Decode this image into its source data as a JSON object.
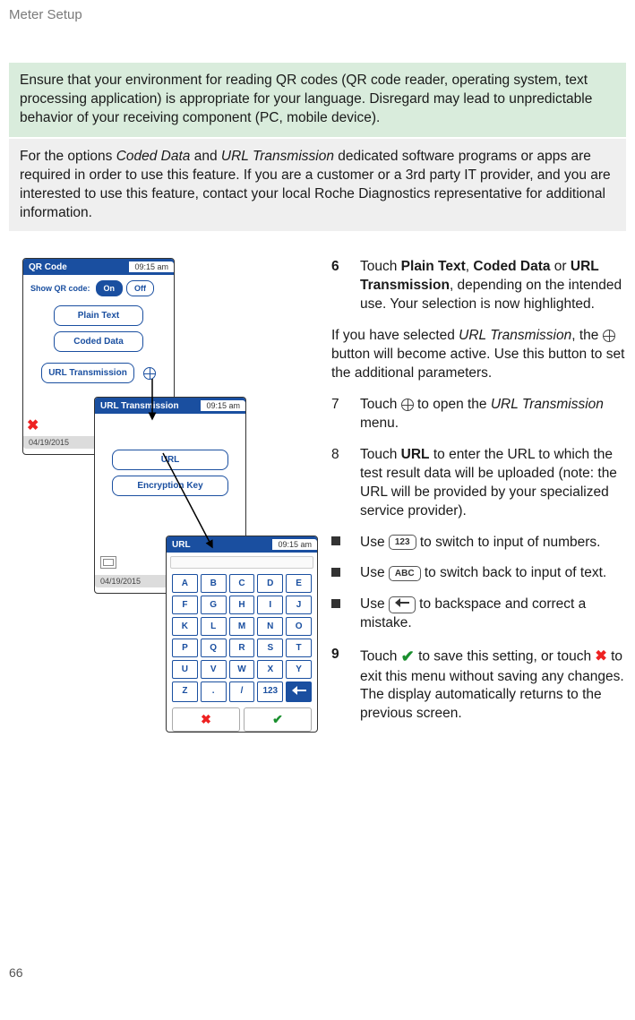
{
  "header": "Meter Setup",
  "page_number": "66",
  "note_green": "Ensure that your environment for reading QR codes (QR code reader, operating system, text processing application) is appropriate for your language. Disregard may lead to unpredictable behavior of your receiving component (PC, mobile device).",
  "note_grey_pre": "For the options ",
  "note_grey_it1": "Coded Data",
  "note_grey_mid": " and ",
  "note_grey_it2": "URL Transmission",
  "note_grey_post": " dedicated software programs or apps are required in order to use this feature. If you are a customer or a 3rd party IT provider, and you are interested to use this feature, contact your local Roche Diagnostics representative for additional information.",
  "screens": {
    "qr": {
      "title": "QR Code",
      "time": "09:15 am",
      "show_label": "Show QR code:",
      "on": "On",
      "off": "Off",
      "opt_plain": "Plain Text",
      "opt_coded": "Coded Data",
      "opt_url": "URL Transmission",
      "date": "04/19/2015"
    },
    "urltrans": {
      "title": "URL Transmission",
      "time": "09:15 am",
      "btn_url": "URL",
      "btn_enc": "Encryption Key",
      "date": "04/19/2015"
    },
    "urlkb": {
      "title": "URL",
      "time": "09:15 am",
      "keys": [
        "A",
        "B",
        "C",
        "D",
        "E",
        "F",
        "G",
        "H",
        "I",
        "J",
        "K",
        "L",
        "M",
        "N",
        "O",
        "P",
        "Q",
        "R",
        "S",
        "T",
        "U",
        "V",
        "W",
        "X",
        "Y",
        "Z",
        ".",
        "/",
        "123"
      ]
    }
  },
  "steps": {
    "s6num": "6",
    "s6_a": "Touch ",
    "s6_b": "Plain Text",
    "s6_c": ", ",
    "s6_d": "Coded Data",
    "s6_e": " or ",
    "s6_f": "URL Transmission",
    "s6_g": ", depending on the intended use. Your selection is now highlighted.",
    "p1_a": "If you have selected ",
    "p1_b": "URL Transmission",
    "p1_c": ", the ",
    "p1_d": " button will become active. Use this button to set the additional parameters.",
    "s7num": "7",
    "s7_a": "Touch ",
    "s7_b": " to open the ",
    "s7_c": "URL Transmission",
    "s7_d": " menu.",
    "s8num": "8",
    "s8_a": "Touch ",
    "s8_b": "URL",
    "s8_c": " to enter the URL to which the test result data will be uploaded (note: the URL will be provided by your specialized service provider).",
    "b1_a": "Use ",
    "b1_lbl": "123",
    "b1_b": " to switch to input of numbers.",
    "b2_a": "Use ",
    "b2_lbl": "ABC",
    "b2_b": " to switch back to input of text.",
    "b3_a": "Use ",
    "b3_b": " to backspace and correct a mistake.",
    "s9num": "9",
    "s9_a": "Touch ",
    "s9_b": " to save this setting, or touch ",
    "s9_c": " to exit this menu without saving any changes. The display automatically returns to the previous screen."
  }
}
